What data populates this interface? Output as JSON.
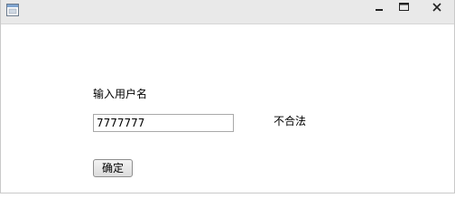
{
  "window": {
    "icons": {
      "app": "app-window-icon",
      "minimize": "minimize-icon",
      "maximize": "maximize-icon",
      "close": "close-icon"
    }
  },
  "form": {
    "username_label": "输入用户名",
    "username_value": "7777777",
    "validation_message": "不合法",
    "confirm_label": "确定"
  }
}
